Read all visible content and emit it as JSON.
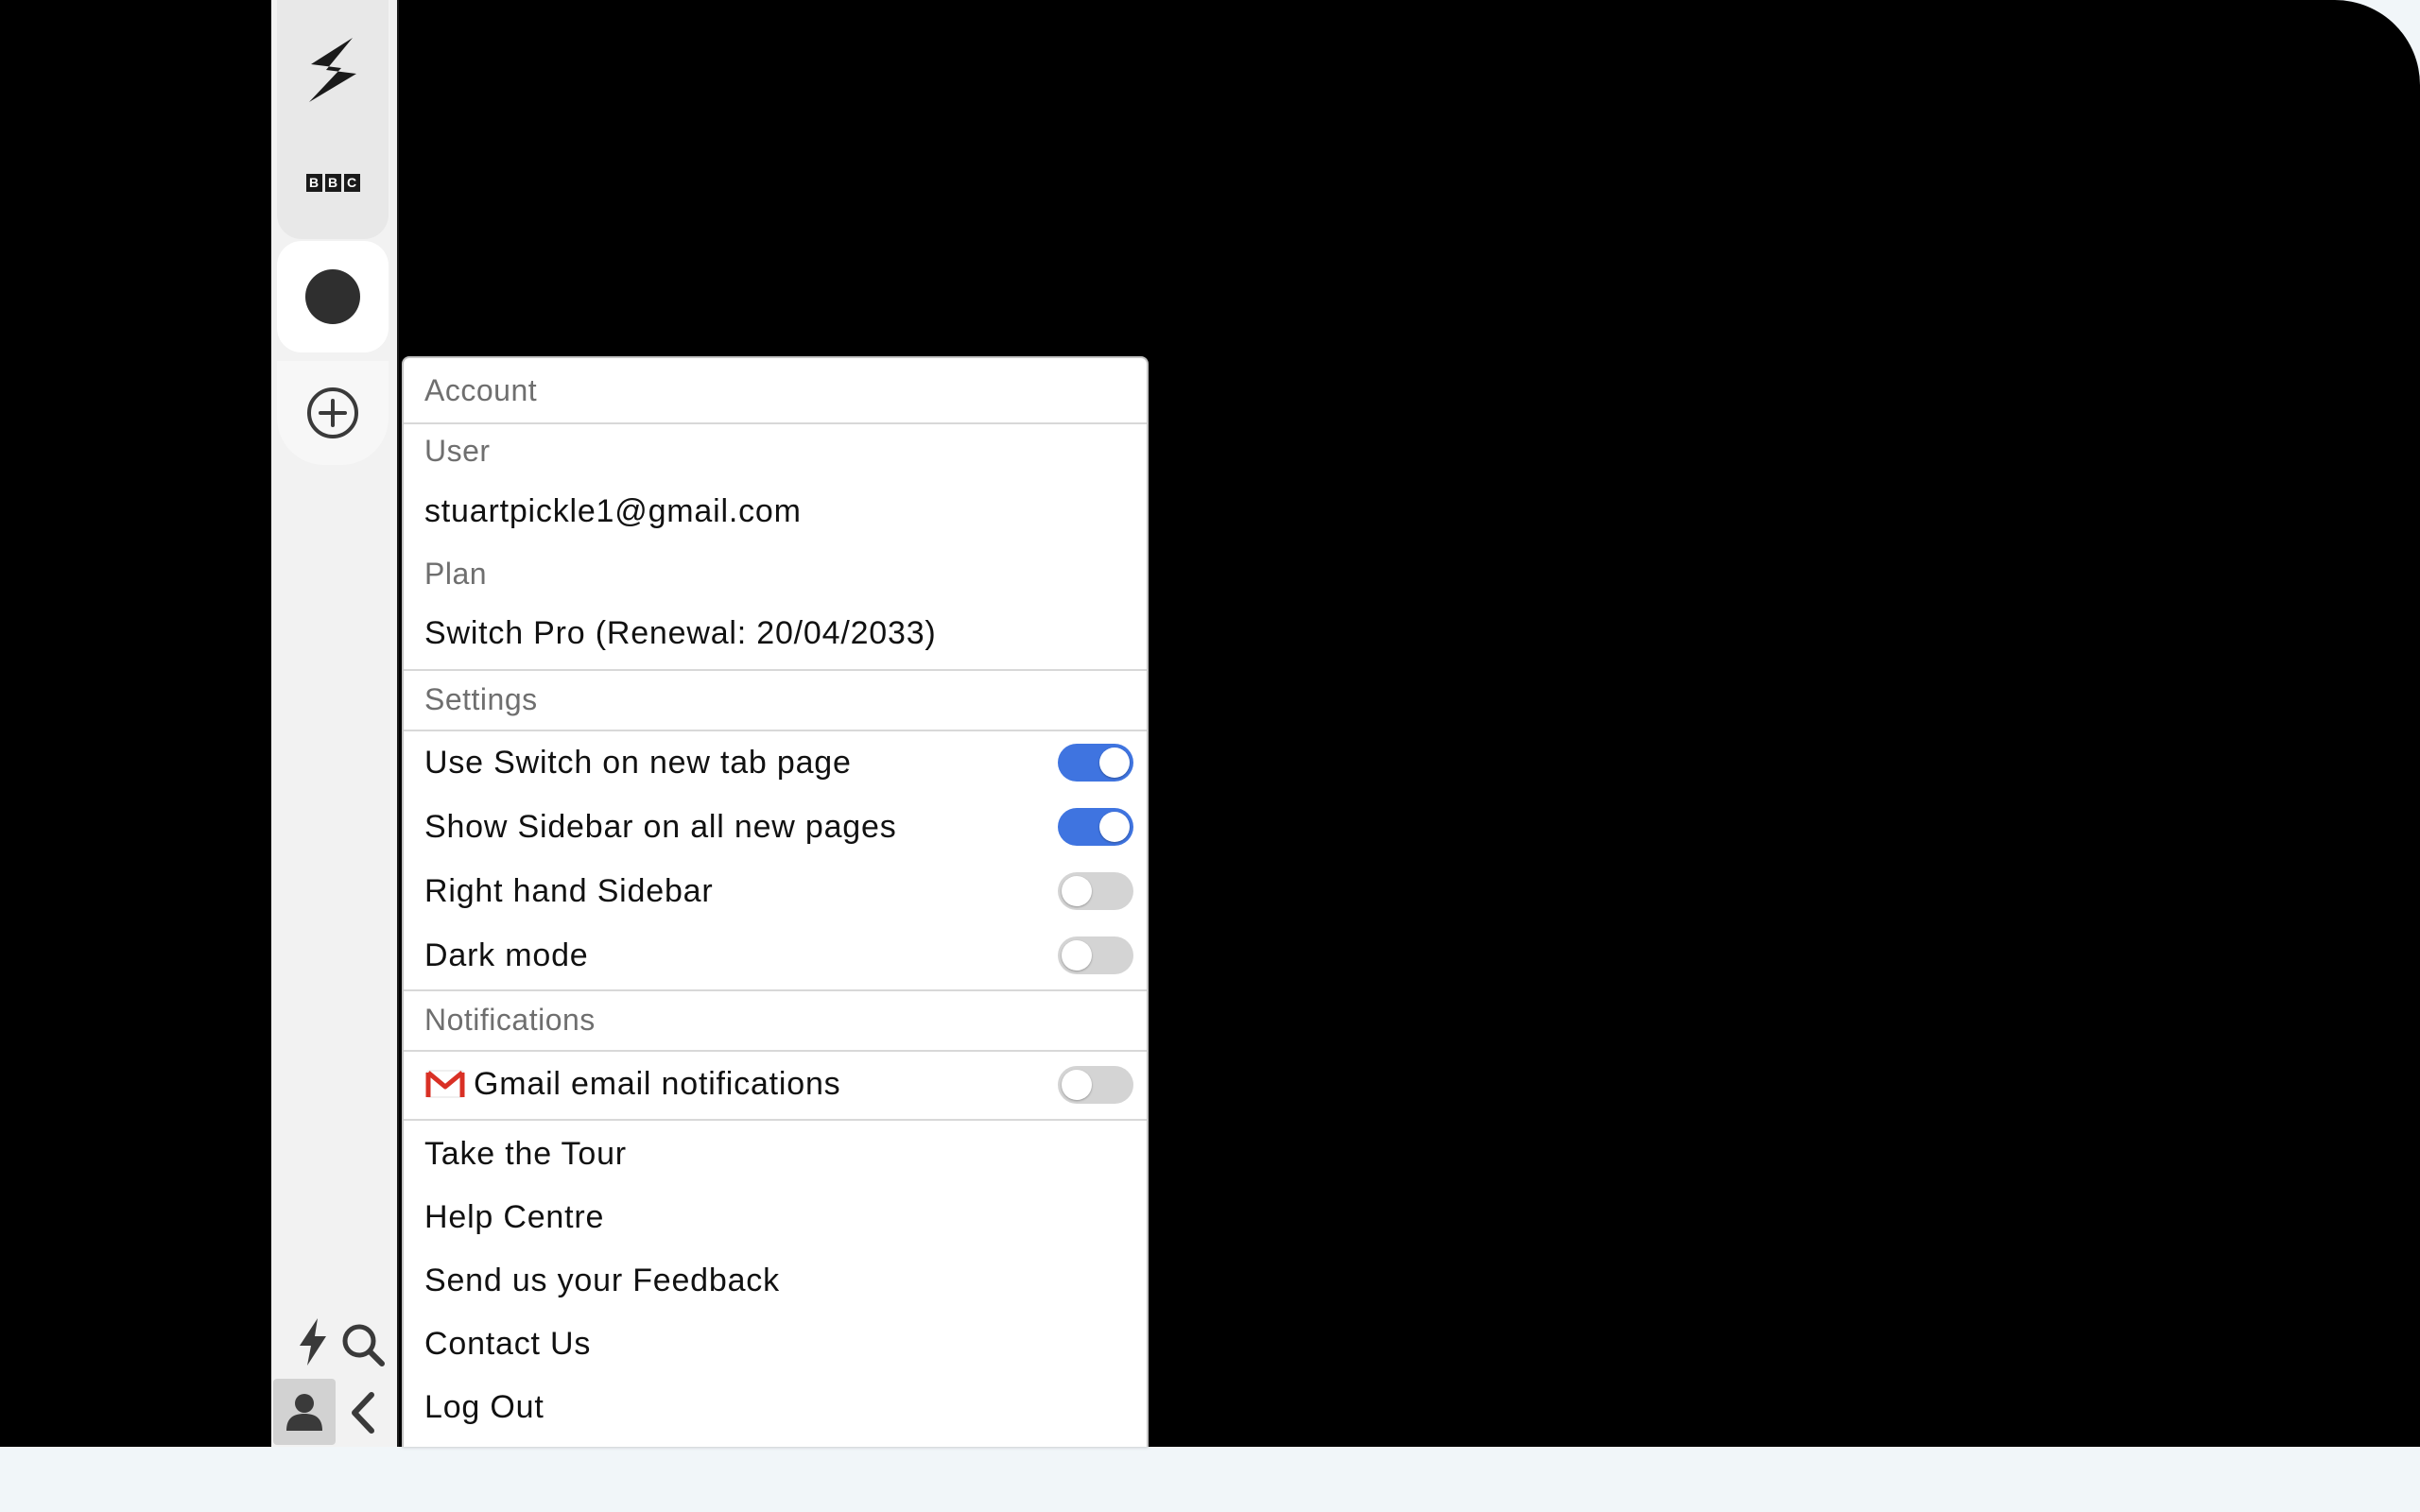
{
  "sidebar": {
    "apps": [
      {
        "name": "Switch",
        "icon": "switch-logo-icon"
      },
      {
        "name": "BBC",
        "icon": "bbc-logo-icon",
        "logo_letters": [
          "B",
          "B",
          "C"
        ]
      }
    ],
    "active_tab_icon": "dark-dot-icon",
    "add_icon": "plus-circle-icon",
    "bottom_icons": [
      "lightning-icon",
      "search-icon",
      "user-icon",
      "chevron-left-icon"
    ]
  },
  "menu": {
    "account_header": "Account",
    "user_label": "User",
    "user_email": "stuartpickle1@gmail.com",
    "plan_label": "Plan",
    "plan_value": "Switch Pro (Renewal: 20/04/2033)",
    "settings_header": "Settings",
    "settings": [
      {
        "label": "Use Switch on new tab page",
        "on": true
      },
      {
        "label": "Show Sidebar on all new pages",
        "on": true
      },
      {
        "label": "Right hand Sidebar",
        "on": false
      },
      {
        "label": "Dark mode",
        "on": false
      }
    ],
    "notifications_header": "Notifications",
    "gmail_label": "Gmail email notifications",
    "gmail_on": false,
    "links": [
      "Take the Tour",
      "Help Centre",
      "Send us your Feedback",
      "Contact Us",
      "Log Out"
    ]
  },
  "colors": {
    "toggle_on": "#3f74e0",
    "toggle_off": "#d4d4d4",
    "gmail_red": "#d93025"
  }
}
